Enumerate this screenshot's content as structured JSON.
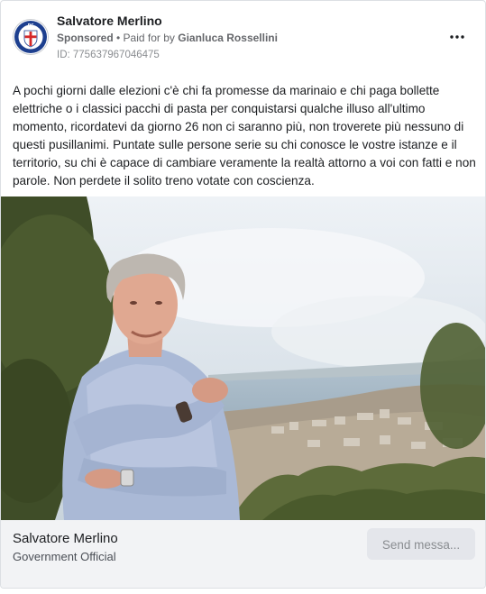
{
  "ad": {
    "page_name": "Salvatore Merlino",
    "sponsored_label": "Sponsored",
    "separator": " • ",
    "paid_for_prefix": "Paid for by ",
    "payer_name": "Gianluca Rossellini",
    "ad_id": "ID: 775637967046475",
    "body_text": "A pochi giorni dalle elezioni c'è chi fa promesse da marinaio e chi paga bollette elettriche o i classici pacchi di pasta per conquistarsi qualche illuso all'ultimo momento, ricordatevi da giorno 26 non ci saranno più, non troverete più nessuno di questi pusillanimi. Puntate sulle persone serie su chi conosce le vostre istanze e il territorio, su chi è capace di cambiare veramente la realtà attorno a voi con fatti e non parole. Non perdete il solito treno votate con coscienza.",
    "avatar_logo_text": "DC",
    "more_icon": "more-horizontal-icon"
  },
  "footer": {
    "title": "Salvatore Merlino",
    "subtitle": "Government Official",
    "cta_label": "Send messa..."
  },
  "colors": {
    "shield_red": "#d62828",
    "logo_blue": "#1d3f8f",
    "cta_bg": "#e4e6eb",
    "footer_bg": "#f2f3f5"
  }
}
